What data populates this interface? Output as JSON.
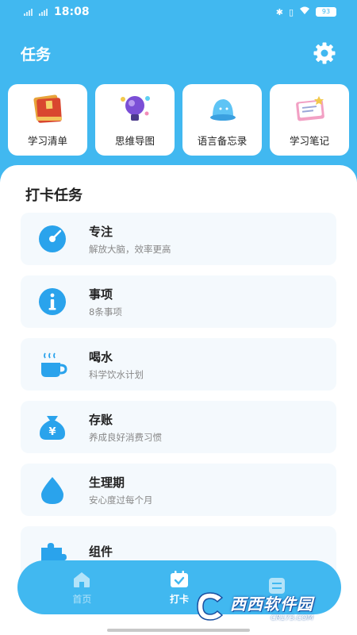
{
  "status_bar": {
    "time": "18:08",
    "battery": "93"
  },
  "header": {
    "title": "任务",
    "settings_icon": "gear-icon"
  },
  "quick_cards": [
    {
      "label": "学习清单",
      "icon": "book-stack-icon"
    },
    {
      "label": "思维导图",
      "icon": "lightbulb-icon"
    },
    {
      "label": "语言备忘录",
      "icon": "bell-icon"
    },
    {
      "label": "学习笔记",
      "icon": "notebook-icon"
    }
  ],
  "section": {
    "title": "打卡任务"
  },
  "tasks": [
    {
      "name": "专注",
      "sub": "解放大脑，效率更高",
      "icon": "focus-icon"
    },
    {
      "name": "事项",
      "sub": "8条事项",
      "icon": "info-icon"
    },
    {
      "name": "喝水",
      "sub": "科学饮水计划",
      "icon": "cup-icon"
    },
    {
      "name": "存账",
      "sub": "养成良好消费习惯",
      "icon": "money-bag-icon"
    },
    {
      "name": "生理期",
      "sub": "安心度过每个月",
      "icon": "drop-icon"
    },
    {
      "name": "组件",
      "sub": "",
      "icon": "puzzle-icon"
    }
  ],
  "bottom_nav": [
    {
      "label": "首页",
      "icon": "home-icon",
      "active": false
    },
    {
      "label": "打卡",
      "icon": "calendar-check-icon",
      "active": true
    },
    {
      "label": "",
      "icon": "list-icon",
      "active": false
    }
  ],
  "watermark": {
    "main": "西西软件园",
    "sub": "CR173.COM"
  },
  "colors": {
    "primary": "#41b8f0",
    "task_bg": "#f4f9fd",
    "icon_blue": "#2aa3ec"
  }
}
